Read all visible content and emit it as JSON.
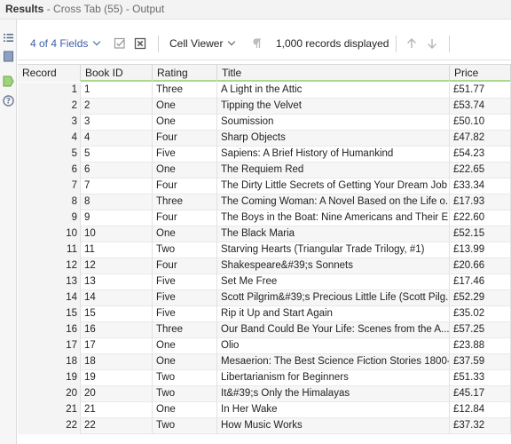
{
  "titlebar": {
    "title": "Results",
    "subtitle": " - Cross Tab (55) - Output"
  },
  "toolbar": {
    "fields_label": "4 of 4 Fields",
    "viewer_label": "Cell Viewer",
    "records_label": "1,000 records displayed"
  },
  "columns": {
    "record": "Record",
    "book_id": "Book ID",
    "rating": "Rating",
    "title": "Title",
    "price": "Price"
  },
  "colors": {
    "accent": "#3d5fa8",
    "header_underline": "#a8d98c",
    "sidebar_active": "#9fd47a"
  },
  "rows": [
    {
      "record": "1",
      "book_id": "1",
      "rating": "Three",
      "title": "A Light in the Attic",
      "price": "£51.77"
    },
    {
      "record": "2",
      "book_id": "2",
      "rating": "One",
      "title": "Tipping the Velvet",
      "price": "£53.74"
    },
    {
      "record": "3",
      "book_id": "3",
      "rating": "One",
      "title": "Soumission",
      "price": "£50.10"
    },
    {
      "record": "4",
      "book_id": "4",
      "rating": "Four",
      "title": "Sharp Objects",
      "price": "£47.82"
    },
    {
      "record": "5",
      "book_id": "5",
      "rating": "Five",
      "title": "Sapiens: A Brief History of Humankind",
      "price": "£54.23"
    },
    {
      "record": "6",
      "book_id": "6",
      "rating": "One",
      "title": "The Requiem Red",
      "price": "£22.65"
    },
    {
      "record": "7",
      "book_id": "7",
      "rating": "Four",
      "title": "The Dirty Little Secrets of Getting Your Dream Job",
      "price": "£33.34"
    },
    {
      "record": "8",
      "book_id": "8",
      "rating": "Three",
      "title": "The Coming Woman: A Novel Based on the Life o...",
      "price": "£17.93"
    },
    {
      "record": "9",
      "book_id": "9",
      "rating": "Four",
      "title": "The Boys in the Boat: Nine Americans and Their E...",
      "price": "£22.60"
    },
    {
      "record": "10",
      "book_id": "10",
      "rating": "One",
      "title": "The Black Maria",
      "price": "£52.15"
    },
    {
      "record": "11",
      "book_id": "11",
      "rating": "Two",
      "title": "Starving Hearts (Triangular Trade Trilogy, #1)",
      "price": "£13.99"
    },
    {
      "record": "12",
      "book_id": "12",
      "rating": "Four",
      "title": "Shakespeare&#39;s Sonnets",
      "price": "£20.66"
    },
    {
      "record": "13",
      "book_id": "13",
      "rating": "Five",
      "title": "Set Me Free",
      "price": "£17.46"
    },
    {
      "record": "14",
      "book_id": "14",
      "rating": "Five",
      "title": "Scott Pilgrim&#39;s Precious Little Life (Scott Pilg...",
      "price": "£52.29"
    },
    {
      "record": "15",
      "book_id": "15",
      "rating": "Five",
      "title": "Rip it Up and Start Again",
      "price": "£35.02"
    },
    {
      "record": "16",
      "book_id": "16",
      "rating": "Three",
      "title": "Our Band Could Be Your Life: Scenes from the A...",
      "price": "£57.25"
    },
    {
      "record": "17",
      "book_id": "17",
      "rating": "One",
      "title": "Olio",
      "price": "£23.88"
    },
    {
      "record": "18",
      "book_id": "18",
      "rating": "One",
      "title": "Mesaerion: The Best Science Fiction Stories 1800-...",
      "price": "£37.59"
    },
    {
      "record": "19",
      "book_id": "19",
      "rating": "Two",
      "title": "Libertarianism for Beginners",
      "price": "£51.33"
    },
    {
      "record": "20",
      "book_id": "20",
      "rating": "Two",
      "title": "It&#39;s Only the Himalayas",
      "price": "£45.17"
    },
    {
      "record": "21",
      "book_id": "21",
      "rating": "One",
      "title": "In Her Wake",
      "price": "£12.84"
    },
    {
      "record": "22",
      "book_id": "22",
      "rating": "Two",
      "title": "How Music Works",
      "price": "£37.32"
    }
  ]
}
